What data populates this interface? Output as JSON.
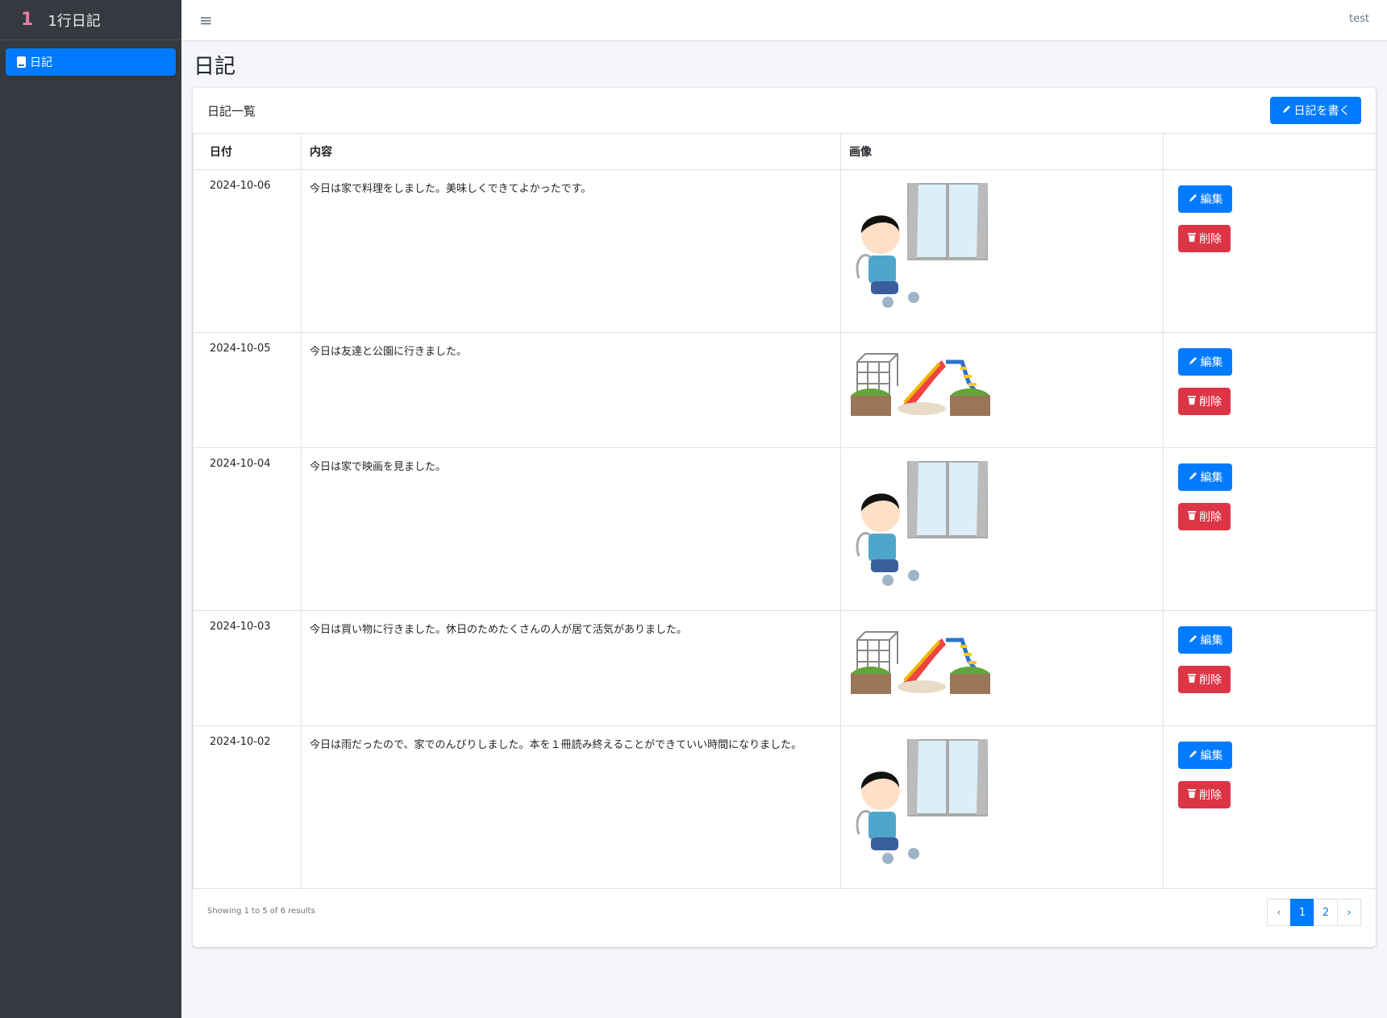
{
  "app": {
    "logo": "1",
    "title": "1行日記"
  },
  "sidebar": {
    "items": [
      {
        "label": "日記",
        "icon": "book-icon",
        "active": true
      }
    ]
  },
  "header": {
    "menu_icon": "≡",
    "user": "test"
  },
  "page": {
    "title": "日記"
  },
  "card": {
    "title": "日記一覧",
    "write_button": "日記を書く",
    "write_icon": "pencil-icon"
  },
  "table": {
    "headers": [
      "日付",
      "内容",
      "画像",
      ""
    ],
    "rows": [
      {
        "date": "2024-10-06",
        "content": "今日は家で料理をしました。美味しくできてよかったです。",
        "image": "boy-sitting-window",
        "edit": "編集",
        "delete": "削除"
      },
      {
        "date": "2024-10-05",
        "content": "今日は友達と公園に行きました。",
        "image": "playground",
        "edit": "編集",
        "delete": "削除"
      },
      {
        "date": "2024-10-04",
        "content": "今日は家で映画を見ました。",
        "image": "boy-sitting-window",
        "edit": "編集",
        "delete": "削除"
      },
      {
        "date": "2024-10-03",
        "content": "今日は買い物に行きました。休日のためたくさんの人が居て活気がありました。",
        "image": "playground",
        "edit": "編集",
        "delete": "削除"
      },
      {
        "date": "2024-10-02",
        "content": "今日は雨だったので、家でのんびりしました。本を１冊読み終えることができていい時間になりました。",
        "image": "boy-sitting-window",
        "edit": "編集",
        "delete": "削除"
      }
    ]
  },
  "pagination": {
    "summary": "Showing 1 to 5 of 6 results",
    "prev": "‹",
    "pages": [
      "1",
      "2"
    ],
    "next": "›",
    "current": "1"
  },
  "colors": {
    "primary": "#007bff",
    "danger": "#dc3545",
    "sidebar": "#343a40"
  }
}
